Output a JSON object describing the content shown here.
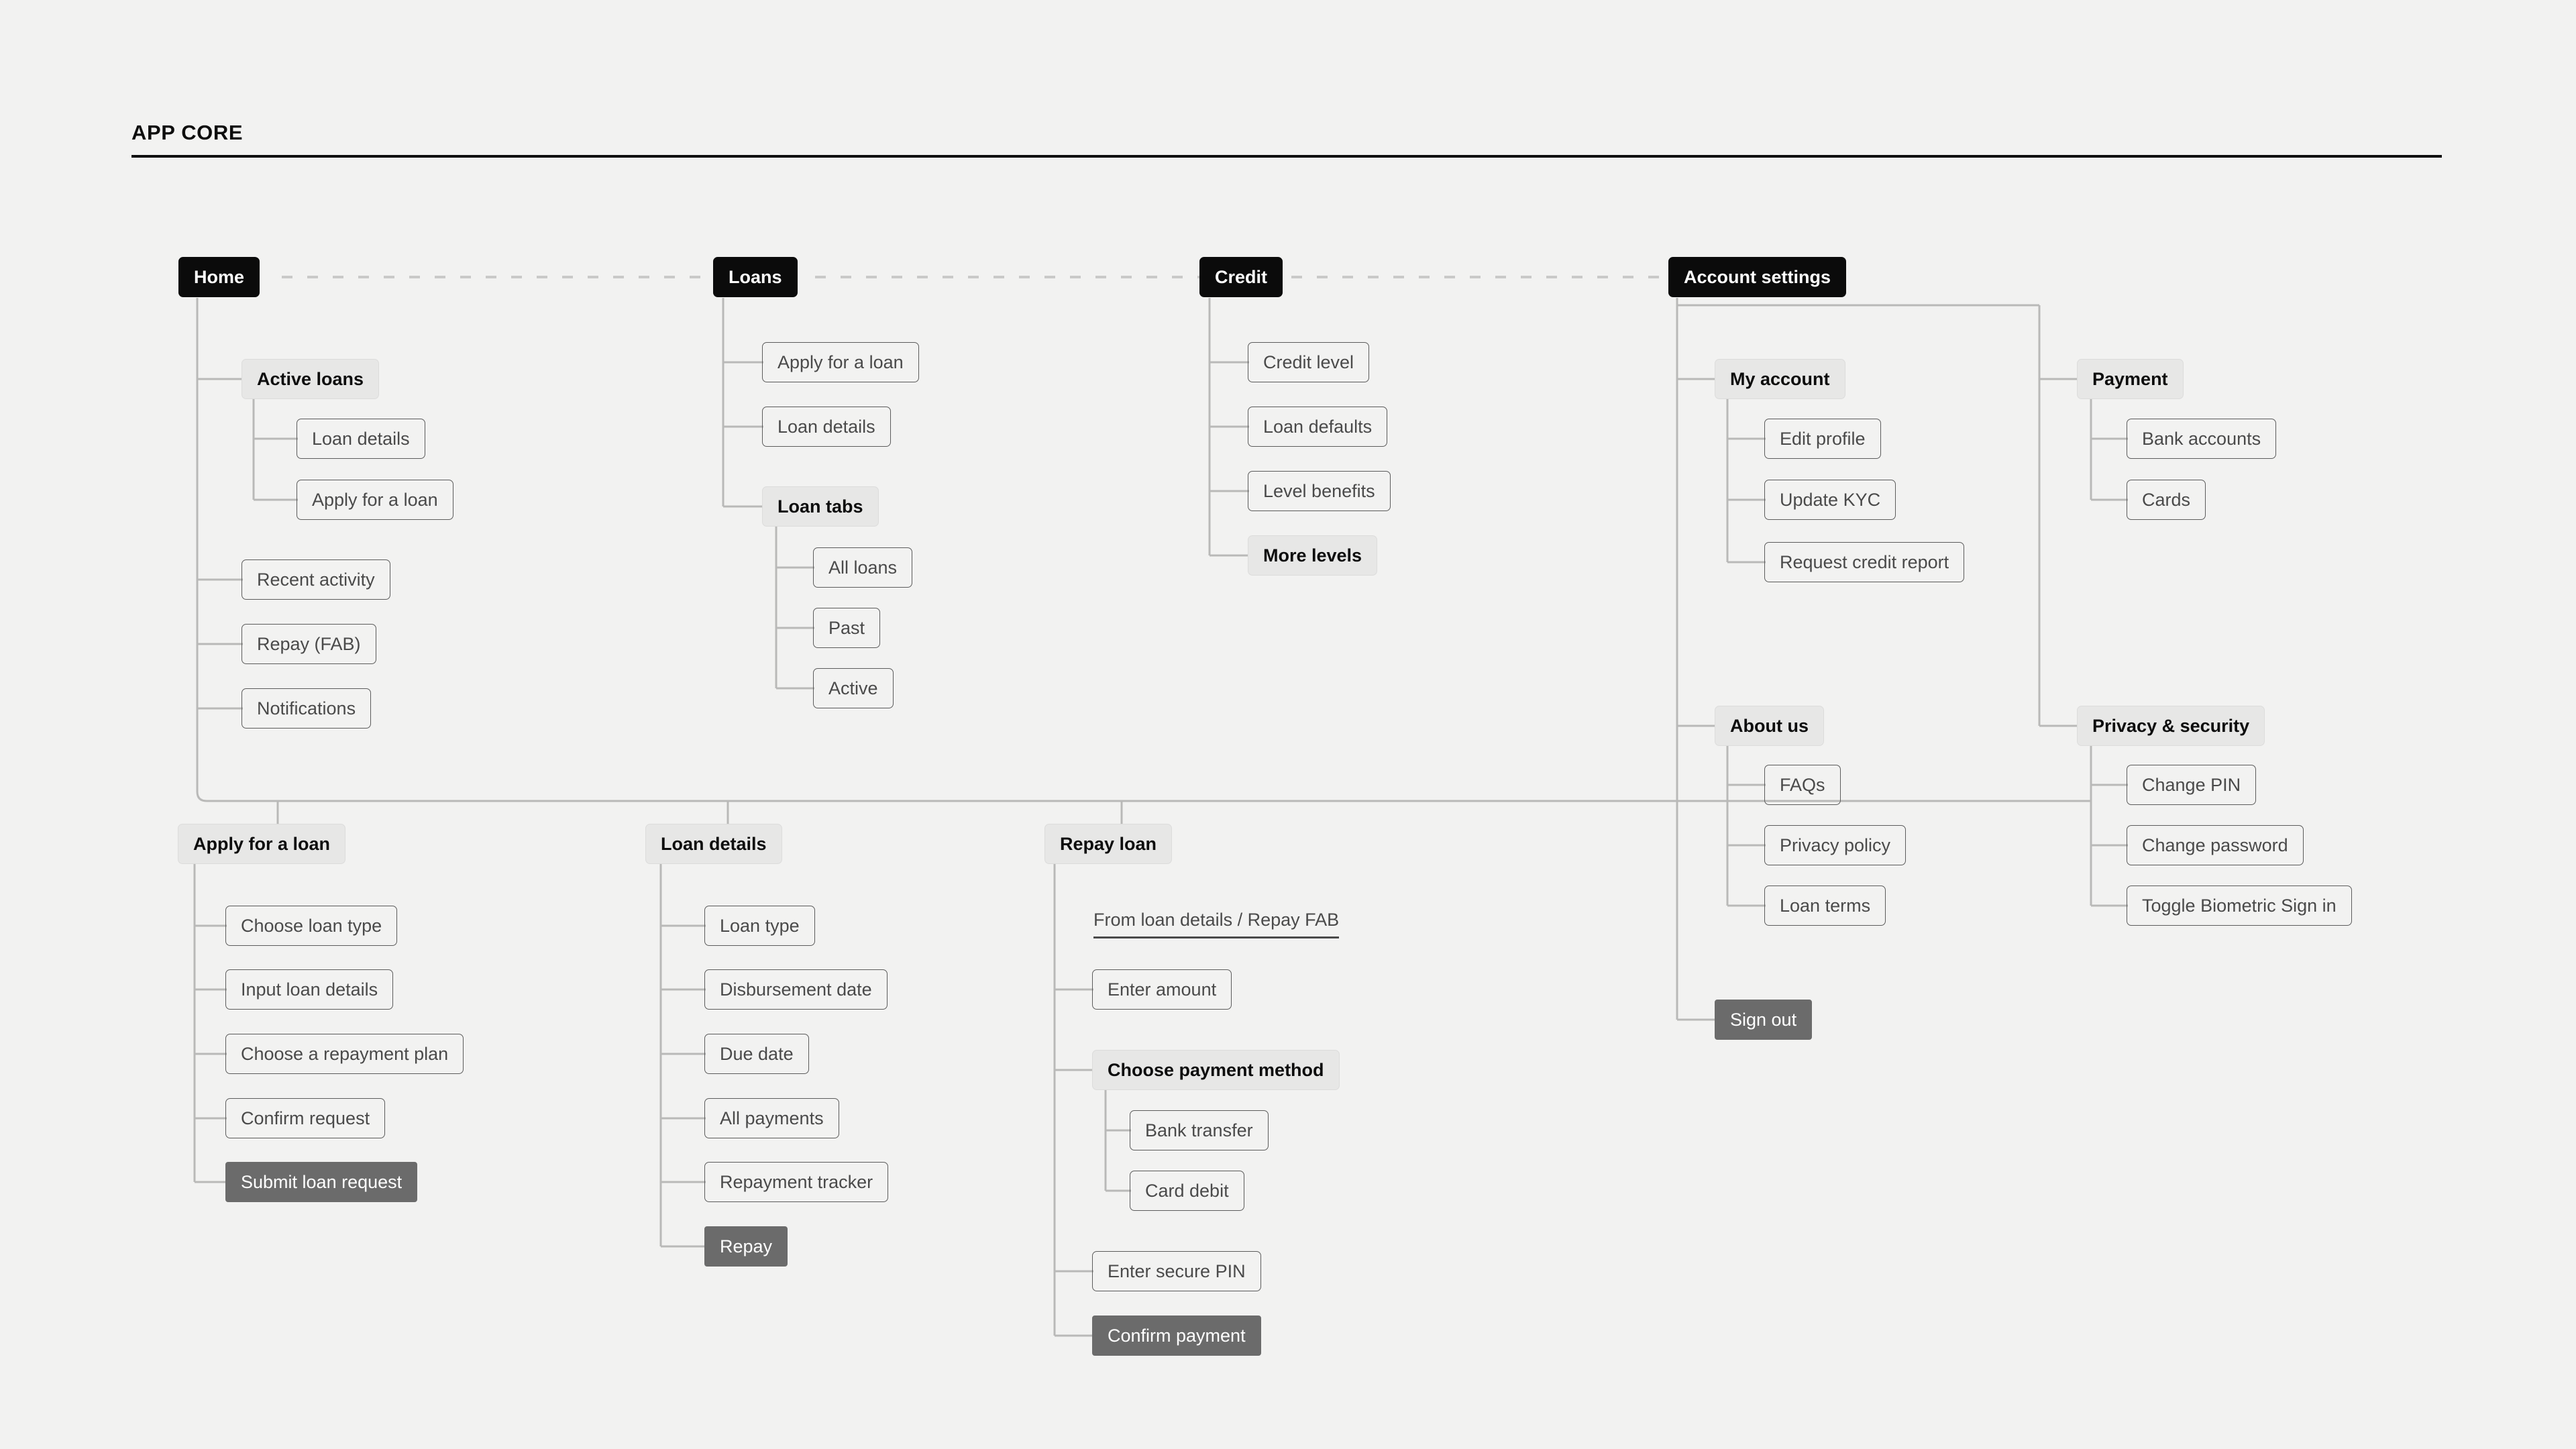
{
  "header": {
    "title": "APP CORE"
  },
  "colors": {
    "background": "#f2f2f1",
    "root_node": "#0b0b0b",
    "section_node": "#e7e7e6",
    "action_node": "#6b6b6b",
    "connector": "#b9b9b8",
    "rule": "#0b0b0b"
  },
  "nodes": {
    "home": "Home",
    "loans": "Loans",
    "credit": "Credit",
    "account_settings": "Account settings",
    "active_loans": "Active loans",
    "active_loans_loan_details": "Loan details",
    "active_loans_apply": "Apply for a loan",
    "recent_activity": "Recent activity",
    "repay_fab": "Repay (FAB)",
    "notifications": "Notifications",
    "loans_apply": "Apply for a loan",
    "loans_loan_details": "Loan details",
    "loan_tabs": "Loan tabs",
    "loan_tabs_all": "All loans",
    "loan_tabs_past": "Past",
    "loan_tabs_active": "Active",
    "credit_level": "Credit level",
    "loan_defaults": "Loan defaults",
    "level_benefits": "Level benefits",
    "more_levels": "More levels",
    "my_account": "My account",
    "edit_profile": "Edit profile",
    "update_kyc": "Update KYC",
    "request_credit_report": "Request credit report",
    "payment": "Payment",
    "bank_accounts": "Bank accounts",
    "cards": "Cards",
    "about_us": "About us",
    "faqs": "FAQs",
    "privacy_policy": "Privacy policy",
    "loan_terms": "Loan terms",
    "privacy_security": "Privacy & security",
    "change_pin": "Change PIN",
    "change_password": "Change password",
    "toggle_biometric": "Toggle Biometric Sign in",
    "sign_out": "Sign out",
    "apply_for_a_loan": "Apply for a loan",
    "choose_loan_type": "Choose loan type",
    "input_loan_details": "Input loan details",
    "choose_repayment_plan": "Choose a repayment plan",
    "confirm_request": "Confirm request",
    "submit_loan_request": "Submit loan request",
    "loan_details": "Loan details",
    "loan_type": "Loan type",
    "disbursement_date": "Disbursement date",
    "due_date": "Due date",
    "all_payments": "All payments",
    "repayment_tracker": "Repayment tracker",
    "repay": "Repay",
    "repay_loan": "Repay loan",
    "repay_loan_source_note": "From loan details / Repay FAB",
    "enter_amount": "Enter amount",
    "choose_payment_method": "Choose payment method",
    "bank_transfer": "Bank transfer",
    "card_debit": "Card debit",
    "enter_secure_pin": "Enter secure PIN",
    "confirm_payment": "Confirm payment"
  }
}
